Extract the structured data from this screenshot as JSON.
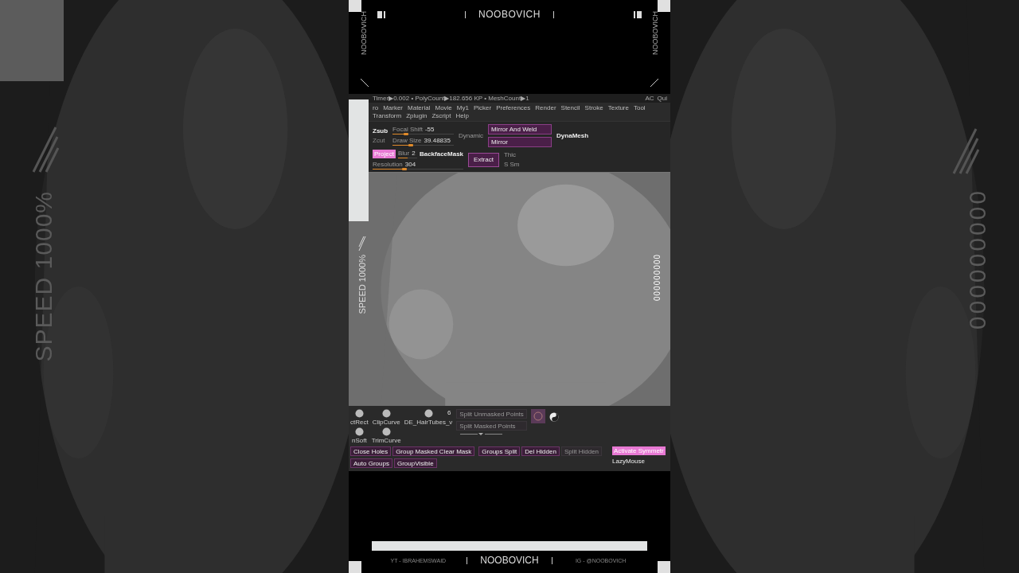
{
  "backdrop": {
    "left_label": "SPEED 1000%",
    "right_label": "000000000"
  },
  "overlay": {
    "top_title": "NOOBOVICH",
    "side_labels": [
      "NOOBOVICH",
      "NOOBOVICH"
    ],
    "speed_label": "SPEED 1000%",
    "counter_label": "000000000"
  },
  "zbrush": {
    "status": "Timer▶0.002 • PolyCount▶182.656 KP • MeshCount▶1",
    "status_right": [
      "AC",
      "Qui"
    ],
    "menu": [
      "ro",
      "Marker",
      "Material",
      "Movie",
      "My1",
      "Picker",
      "Preferences",
      "Render",
      "Stencil",
      "Stroke",
      "Texture",
      "Tool",
      "Transform",
      "Zplugin",
      "Zscript",
      "Help"
    ],
    "toggles": [
      {
        "label": "Zsub",
        "selected": true
      },
      {
        "label": "Zcut",
        "selected": false
      }
    ],
    "sliders": [
      {
        "label": "Focal Shift",
        "value": "-55",
        "level": 0.22
      },
      {
        "label": "Draw Size",
        "value": "39.48835",
        "level": 0.3
      }
    ],
    "dynamic": "Dynamic",
    "mirror_buttons": [
      "Mirror And Weld",
      "Mirror"
    ],
    "dynamesh": "DynaMesh",
    "project": {
      "label": "Project",
      "selected": true
    },
    "blur": {
      "label": "Blur",
      "value": "2",
      "level": 0.5
    },
    "backface": "BackfaceMask",
    "resolution": {
      "label": "Resolution",
      "value": "304",
      "level": 0.35
    },
    "extract": "Extract",
    "edge_labels": [
      "Thic",
      "S Sm"
    ],
    "brushes": [
      {
        "label": "ctRect"
      },
      {
        "label": "ClipCurve"
      },
      {
        "label": "DE_HairTubes_v",
        "badge": "6"
      }
    ],
    "brushes_2": [
      {
        "label": "nSoft"
      },
      {
        "label": "TrimCurve"
      }
    ],
    "split_buttons": [
      {
        "label": "Split Unmasked Points",
        "disabled": true
      },
      {
        "label": "Split Masked Points",
        "disabled": true
      }
    ],
    "button_rows": [
      [
        {
          "label": "Close Holes",
          "disabled": false
        },
        {
          "label": "Group Masked Clear Mask",
          "disabled": false
        }
      ],
      [
        {
          "label": "Auto Groups",
          "disabled": false
        },
        {
          "label": "GroupVisible",
          "disabled": false
        }
      ]
    ],
    "bottom_buttons": [
      {
        "label": "Groups Split",
        "disabled": false
      },
      {
        "label": "Del Hidden",
        "disabled": false
      },
      {
        "label": "Split Hidden",
        "disabled": true
      }
    ],
    "symmetry": {
      "label": "Activate Symmetr",
      "selected": true
    },
    "lazymouse": "LazyMouse"
  },
  "footer": {
    "left": "YT - IBRAHEMSWAID",
    "center": "NOOBOVICH",
    "right": "IG - @NOOBOVICH"
  }
}
